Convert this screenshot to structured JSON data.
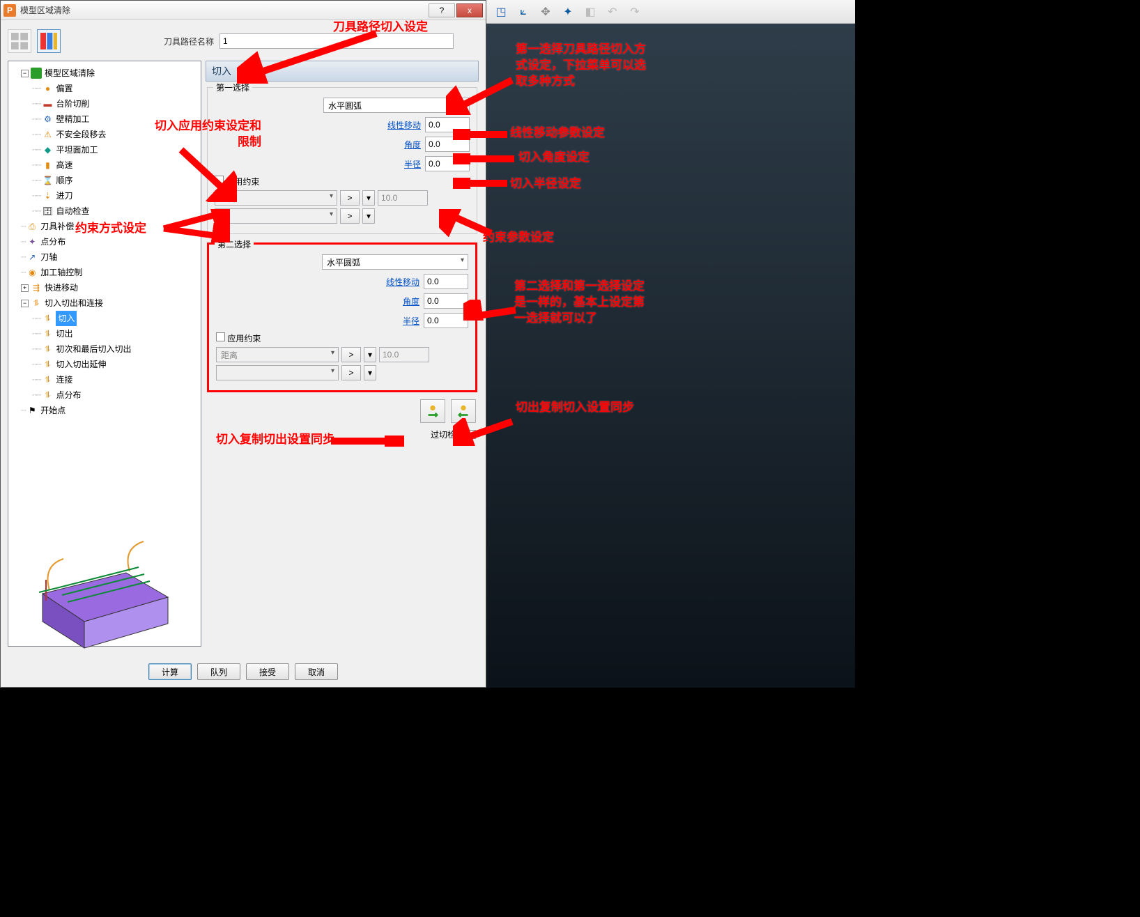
{
  "window": {
    "title": "模型区域清除",
    "help_btn": "?",
    "close_btn": "x"
  },
  "top": {
    "path_name_label": "刀具路径名称",
    "path_name_value": "1"
  },
  "tree": {
    "root": "模型区域清除",
    "n_offset": "偏置",
    "n_step": "台阶切削",
    "n_wall": "壁精加工",
    "n_unsafe": "不安全段移去",
    "n_flat": "平坦面加工",
    "n_highspeed": "高速",
    "n_order": "顺序",
    "n_approach": "进刀",
    "n_autocheck": "自动检查",
    "n_toolcomp": "刀具补偿",
    "n_pointdist": "点分布",
    "n_toolaxis": "刀轴",
    "n_axisctrl": "加工轴控制",
    "n_rapid": "快进移动",
    "n_leads": "切入切出和连接",
    "n_leadin": "切入",
    "n_leadout": "切出",
    "n_firstlast": "初次和最后切入切出",
    "n_leadext": "切入切出延伸",
    "n_links": "连接",
    "n_pointdist2": "点分布",
    "n_startpt": "开始点"
  },
  "panel": {
    "section_title": "切入",
    "first_choice_legend": "第一选择",
    "second_choice_legend": "第二选择",
    "dropdown_value": "水平圆弧",
    "lbl_linear": "线性移动",
    "lbl_angle": "角度",
    "lbl_radius": "半径",
    "val_linear": "0.0",
    "val_angle": "0.0",
    "val_radius": "0.0",
    "apply_constraint": "应用约束",
    "constraint_distance": "距离",
    "constraint_value": "10.0",
    "gt": ">",
    "overcut_check": "过切检查"
  },
  "buttons": {
    "calculate": "计算",
    "queue": "队列",
    "accept": "接受",
    "cancel": "取消"
  },
  "annotations": {
    "a_top": "刀具路径切入设定",
    "a_first": "第一选择刀具路径切入方式设定，下拉菜单可以选取多种方式",
    "a_linear": "线性移动参数设定",
    "a_angle": "切入角度设定",
    "a_radius": "切入半径设定",
    "a_constraint_left": "切入应用约束设定和限制",
    "a_constraint_type": "约束方式设定",
    "a_constraint_param": "约束参数设定",
    "a_second": "第二选择和第一选择设定是一样的，基本上设定第一选择就可以了",
    "a_copy_lr": "切入复制切出设置同步",
    "a_copy_rl": "切出复制切入设置同步"
  }
}
